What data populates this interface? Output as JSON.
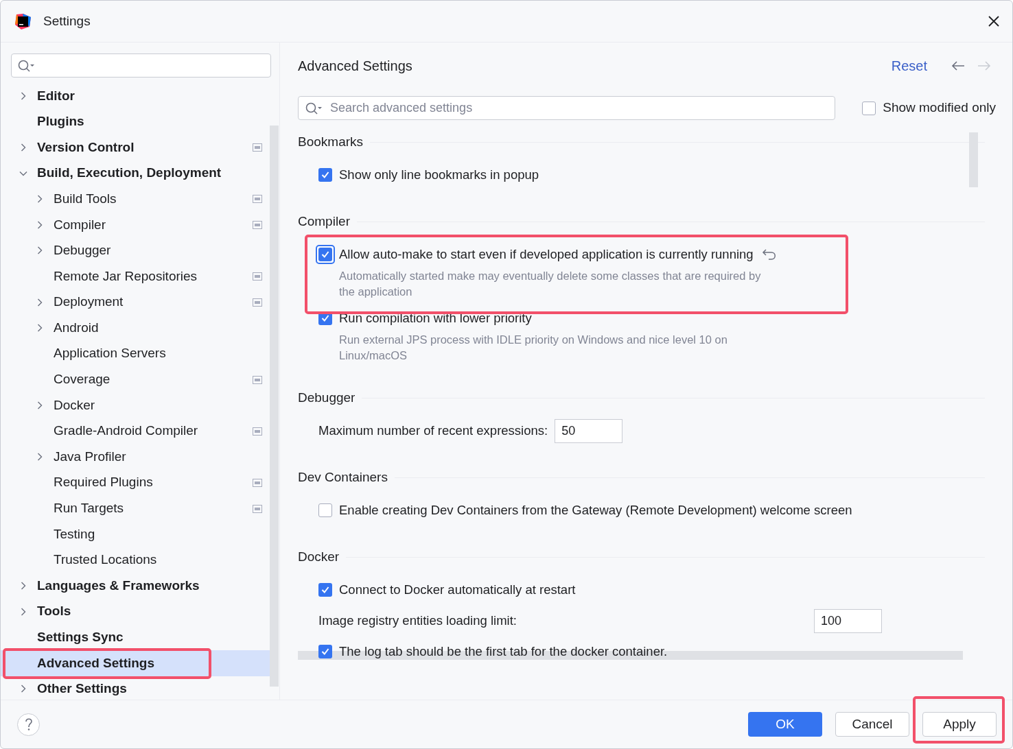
{
  "window": {
    "title": "Settings"
  },
  "sidebar": {
    "items": [
      {
        "label": "Editor",
        "expandable": true,
        "expanded": false,
        "selected": false,
        "project_icon": false
      },
      {
        "label": "Plugins",
        "expandable": false,
        "expanded": false,
        "selected": false,
        "project_icon": false
      },
      {
        "label": "Version Control",
        "expandable": true,
        "expanded": false,
        "selected": false,
        "project_icon": true
      },
      {
        "label": "Build, Execution, Deployment",
        "expandable": true,
        "expanded": true,
        "selected": false,
        "project_icon": false,
        "children": [
          {
            "label": "Build Tools",
            "expandable": true,
            "expanded": false,
            "selected": false,
            "project_icon": true
          },
          {
            "label": "Compiler",
            "expandable": true,
            "expanded": false,
            "selected": false,
            "project_icon": true
          },
          {
            "label": "Debugger",
            "expandable": true,
            "expanded": false,
            "selected": false,
            "project_icon": false
          },
          {
            "label": "Remote Jar Repositories",
            "expandable": false,
            "expanded": false,
            "selected": false,
            "project_icon": true
          },
          {
            "label": "Deployment",
            "expandable": true,
            "expanded": false,
            "selected": false,
            "project_icon": true
          },
          {
            "label": "Android",
            "expandable": true,
            "expanded": false,
            "selected": false,
            "project_icon": false
          },
          {
            "label": "Application Servers",
            "expandable": false,
            "expanded": false,
            "selected": false,
            "project_icon": false
          },
          {
            "label": "Coverage",
            "expandable": false,
            "expanded": false,
            "selected": false,
            "project_icon": true
          },
          {
            "label": "Docker",
            "expandable": true,
            "expanded": false,
            "selected": false,
            "project_icon": false
          },
          {
            "label": "Gradle-Android Compiler",
            "expandable": false,
            "expanded": false,
            "selected": false,
            "project_icon": true
          },
          {
            "label": "Java Profiler",
            "expandable": true,
            "expanded": false,
            "selected": false,
            "project_icon": false
          },
          {
            "label": "Required Plugins",
            "expandable": false,
            "expanded": false,
            "selected": false,
            "project_icon": true
          },
          {
            "label": "Run Targets",
            "expandable": false,
            "expanded": false,
            "selected": false,
            "project_icon": true
          },
          {
            "label": "Testing",
            "expandable": false,
            "expanded": false,
            "selected": false,
            "project_icon": false
          },
          {
            "label": "Trusted Locations",
            "expandable": false,
            "expanded": false,
            "selected": false,
            "project_icon": false
          }
        ]
      },
      {
        "label": "Languages & Frameworks",
        "expandable": true,
        "expanded": false,
        "selected": false,
        "project_icon": false
      },
      {
        "label": "Tools",
        "expandable": true,
        "expanded": false,
        "selected": false,
        "project_icon": false
      },
      {
        "label": "Settings Sync",
        "expandable": false,
        "expanded": false,
        "selected": false,
        "project_icon": false
      },
      {
        "label": "Advanced Settings",
        "expandable": false,
        "expanded": false,
        "selected": true,
        "project_icon": false
      },
      {
        "label": "Other Settings",
        "expandable": true,
        "expanded": false,
        "selected": false,
        "project_icon": false
      }
    ]
  },
  "content": {
    "title": "Advanced Settings",
    "reset": "Reset",
    "back_enabled": true,
    "forward_enabled": false,
    "search": {
      "placeholder": "Search advanced settings"
    },
    "show_modified_only": {
      "label": "Show modified only",
      "checked": false
    },
    "sections": [
      {
        "title": "Bookmarks",
        "items": [
          {
            "kind": "checkbox",
            "label": "Show only line bookmarks in popup",
            "checked": true,
            "focused": false,
            "modified": false
          }
        ]
      },
      {
        "title": "Compiler",
        "items": [
          {
            "kind": "checkbox",
            "label": "Allow auto-make to start even if developed application is currently running",
            "checked": true,
            "focused": true,
            "modified": true,
            "description": "Automatically started make may eventually delete some classes that are required by the application"
          },
          {
            "kind": "checkbox",
            "label": "Run compilation with lower priority",
            "checked": true,
            "focused": false,
            "modified": false,
            "description": "Run external JPS process with IDLE priority on Windows and nice level 10 on Linux/macOS"
          }
        ]
      },
      {
        "title": "Debugger",
        "items": [
          {
            "kind": "number",
            "label": "Maximum number of recent expressions:",
            "value": "50"
          }
        ]
      },
      {
        "title": "Dev Containers",
        "items": [
          {
            "kind": "checkbox",
            "label": "Enable creating Dev Containers from the Gateway (Remote Development) welcome screen",
            "checked": false,
            "focused": false,
            "modified": false
          }
        ]
      },
      {
        "title": "Docker",
        "items": [
          {
            "kind": "checkbox",
            "label": "Connect to Docker automatically at restart",
            "checked": true,
            "focused": false,
            "modified": false
          },
          {
            "kind": "number_right",
            "label": "Image registry entities loading limit:",
            "value": "100"
          },
          {
            "kind": "checkbox",
            "label": "The log tab should be the first tab for the docker container.",
            "checked": true,
            "focused": false,
            "modified": false
          }
        ]
      }
    ]
  },
  "buttons": [
    {
      "label": "OK",
      "kind": "primary"
    },
    {
      "label": "Cancel",
      "kind": "secondary"
    },
    {
      "label": "Apply",
      "kind": "secondary"
    }
  ]
}
